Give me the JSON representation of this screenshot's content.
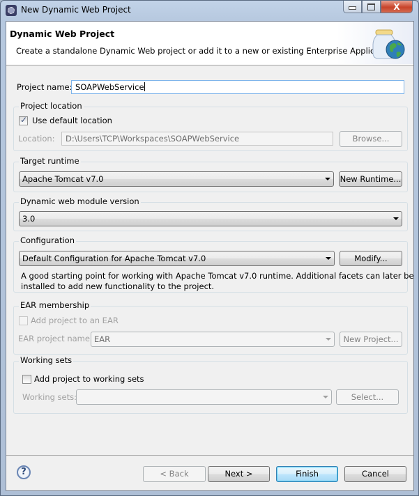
{
  "window": {
    "title": "New Dynamic Web Project",
    "controls": {
      "minimize": "minimize",
      "maximize": "maximize",
      "close": "X"
    }
  },
  "banner": {
    "title": "Dynamic Web Project",
    "description": "Create a standalone Dynamic Web project or add it to a new or existing Enterprise Application."
  },
  "project_name": {
    "label": "Project name:",
    "value": "SOAPWebService"
  },
  "project_location": {
    "title": "Project location",
    "use_default_label": "Use default location",
    "use_default_checked": true,
    "location_label": "Location:",
    "location_value": "D:\\Users\\TCP\\Workspaces\\SOAPWebService",
    "browse_label": "Browse..."
  },
  "target_runtime": {
    "title": "Target runtime",
    "selected": "Apache Tomcat v7.0",
    "new_runtime_label": "New Runtime..."
  },
  "web_module": {
    "title": "Dynamic web module version",
    "selected": "3.0"
  },
  "configuration": {
    "title": "Configuration",
    "selected": "Default Configuration for Apache Tomcat v7.0",
    "modify_label": "Modify...",
    "description_line1": "A good starting point for working with Apache Tomcat v7.0 runtime. Additional facets can later be",
    "description_line2": "installed to add new functionality to the project."
  },
  "ear_membership": {
    "title": "EAR membership",
    "add_label": "Add project to an EAR",
    "add_checked": false,
    "ear_name_label": "EAR project name:",
    "ear_name_value": "EAR",
    "new_project_label": "New Project..."
  },
  "working_sets": {
    "title": "Working sets",
    "add_label": "Add project to working sets",
    "add_checked": false,
    "sets_label": "Working sets:",
    "sets_value": "",
    "select_label": "Select..."
  },
  "footer": {
    "help_glyph": "?",
    "back_label": "< Back",
    "next_label": "Next >",
    "finish_label": "Finish",
    "cancel_label": "Cancel"
  }
}
